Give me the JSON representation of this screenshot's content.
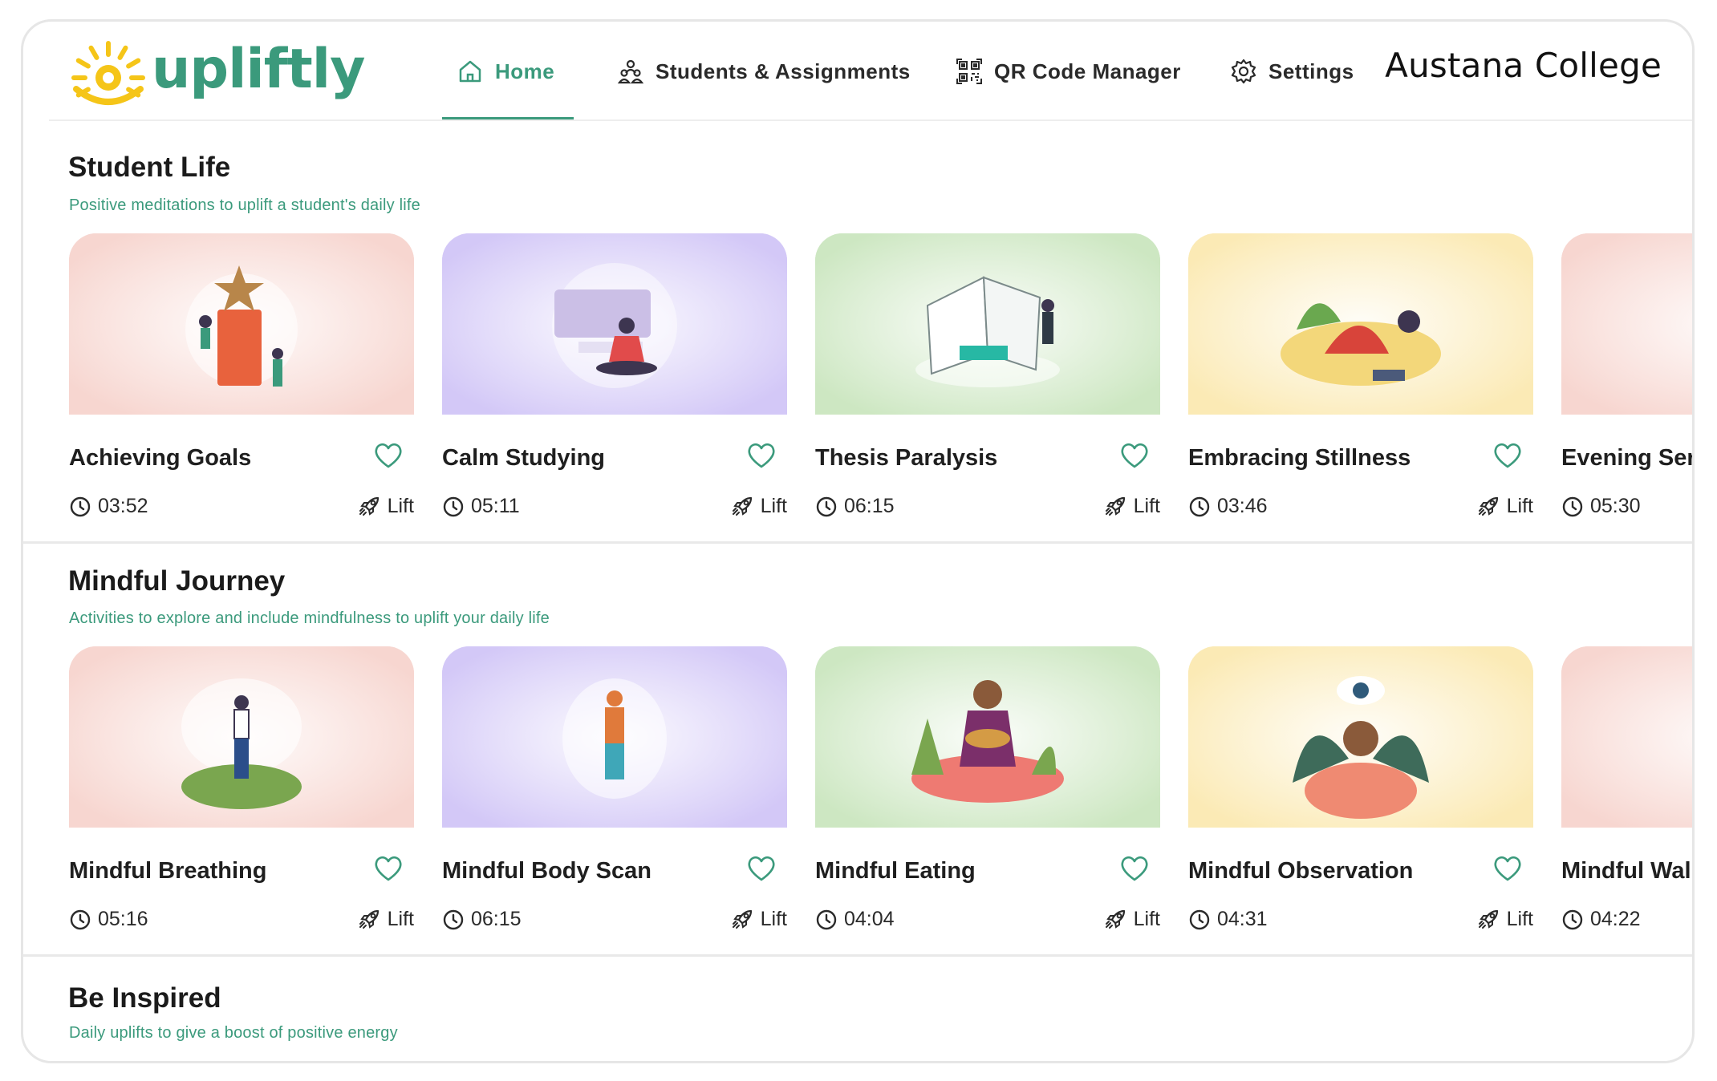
{
  "app": {
    "brand": "upliftly",
    "college": "Austana College",
    "accent": "#3b9a7c",
    "logo_sun": "#f5c518"
  },
  "nav": {
    "home": {
      "label": "Home",
      "icon": "home-icon"
    },
    "students": {
      "label": "Students & Assignments",
      "icon": "people-icon"
    },
    "qr": {
      "label": "QR Code Manager",
      "icon": "qr-code-icon"
    },
    "settings": {
      "label": "Settings",
      "icon": "gear-icon"
    }
  },
  "lift_label": "Lift",
  "sections": [
    {
      "title": "Student Life",
      "subtitle": "Positive meditations to uplift a student's daily life",
      "cards": [
        {
          "title": "Achieving Goals",
          "duration": "03:52",
          "bg": "#f7d6d0"
        },
        {
          "title": "Calm Studying",
          "duration": "05:11",
          "bg": "#d3c8f7"
        },
        {
          "title": "Thesis Paralysis",
          "duration": "06:15",
          "bg": "#cde7c2"
        },
        {
          "title": "Embracing Stillness",
          "duration": "03:46",
          "bg": "#fbeab5"
        },
        {
          "title": "Evening Sere",
          "duration": "05:30",
          "bg": "#f7d6d0"
        }
      ]
    },
    {
      "title": "Mindful Journey",
      "subtitle": "Activities to explore and include mindfulness to uplift your daily life",
      "cards": [
        {
          "title": "Mindful Breathing",
          "duration": "05:16",
          "bg": "#f7d6d0"
        },
        {
          "title": "Mindful Body Scan",
          "duration": "06:15",
          "bg": "#d3c8f7"
        },
        {
          "title": "Mindful Eating",
          "duration": "04:04",
          "bg": "#cde7c2"
        },
        {
          "title": "Mindful Observation",
          "duration": "04:31",
          "bg": "#fbeab5"
        },
        {
          "title": "Mindful Wall",
          "duration": "04:22",
          "bg": "#f7d6d0"
        }
      ]
    },
    {
      "title": "Be Inspired",
      "subtitle": "Daily uplifts to give a boost of positive energy",
      "cards": []
    }
  ]
}
